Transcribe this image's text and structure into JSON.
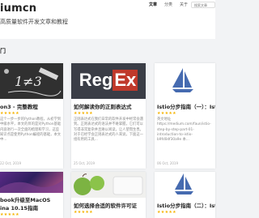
{
  "header": {
    "brand": "iumcn",
    "tagline": "高质量软件开发文章和教程",
    "nav": [
      "文章",
      "分类",
      "关于",
      "联系"
    ],
    "search_placeholder": "搜索文章",
    "section_mark": "门"
  },
  "cards": [
    {
      "title": "on3 - 完整教程",
      "stars": "★★★★★",
      "excerpt": "这个一步一步的Python教程，从初学到中级水平，本文的目的是对Python基础内容进行一次全面的梳理和学习，这些知识点是使用Python编程的基础，本文中...",
      "date": "22 Oct, 2019",
      "thumb": "python-handwriting"
    },
    {
      "title": "如何解读你的正则表达式",
      "stars": "★★★★★",
      "excerpt": "正则表达式在我们日常的软件开发中经常会遇到。正则表达式的语法并不难掌握，它们可以写得非常复杂并且难以阅读，让人望而生畏。对于已经学会正则表达式的人来说，下面这一组有用的工具...",
      "date": "25 Oct, 2019",
      "thumb": "regex-logo",
      "logo_reg": "Reg",
      "logo_ex": "Ex"
    },
    {
      "title": "Istio分步指南（一）：Ist",
      "stars": "★★★★★",
      "excerpt": "英文地址 https://medium.com/faun/istio-step-by-step-part-01-introduction-to-istio-b9fd0df30a9e 本...",
      "date": "06 Oct, 2019",
      "thumb": "istio-sail"
    },
    {
      "title": "book升级至MacOS",
      "title2": "ina 10.15指南",
      "stars": "★★★★★",
      "thumb": "macos"
    },
    {
      "title": "如何选择合适的软件许可证",
      "stars": "★★★★★",
      "thumb": "apple-license"
    },
    {
      "title": "Istio分步指南（二）：Ist",
      "stars": "★★★★★",
      "thumb": "istio-sail"
    }
  ],
  "colors": {
    "star": "#f5b301",
    "regex_red": "#c0392b",
    "istio_blue": "#466bb0"
  }
}
